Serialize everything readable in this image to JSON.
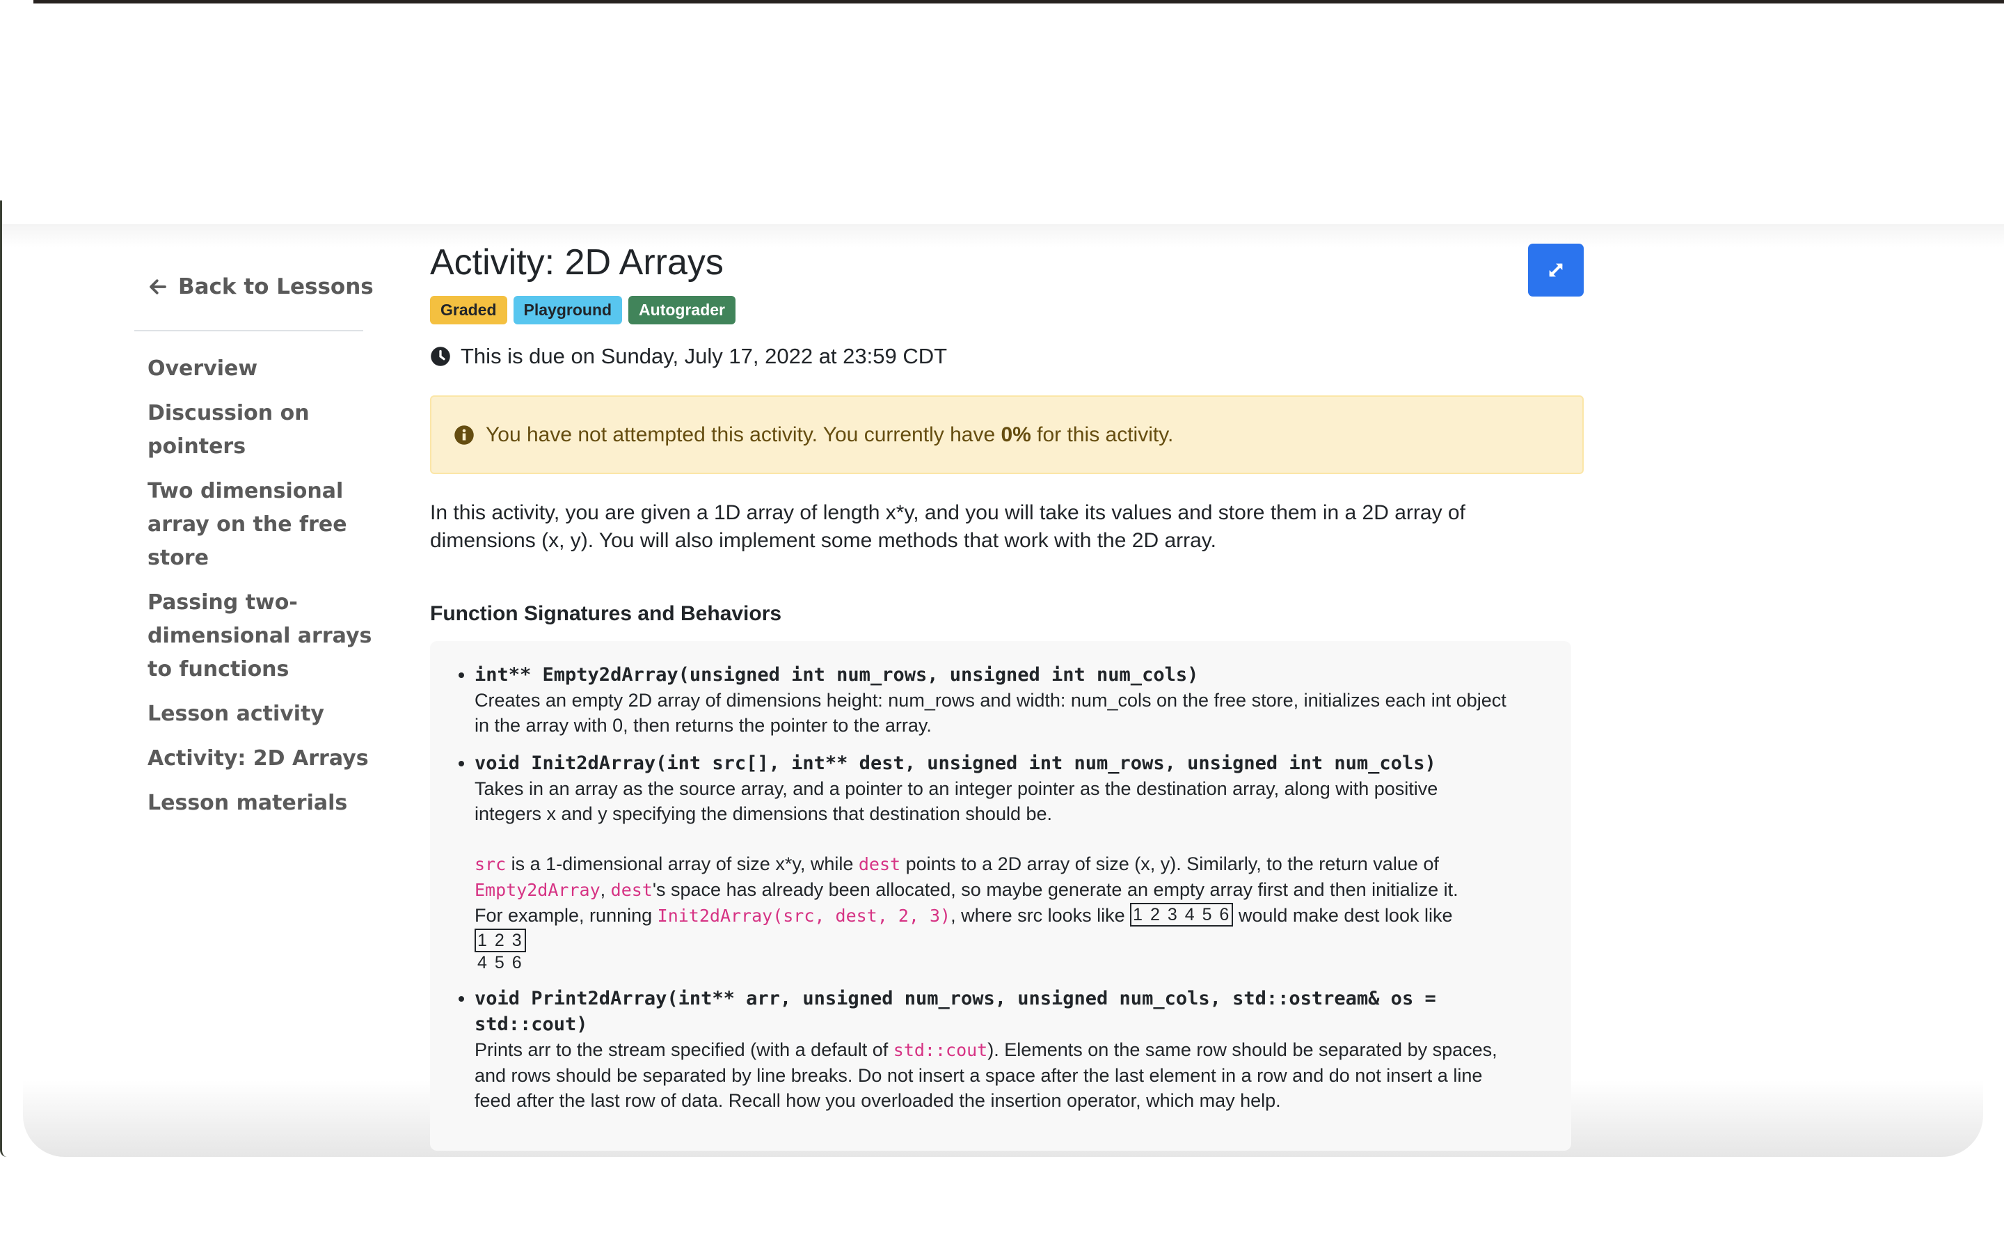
{
  "sidebar": {
    "back_label": "Back to Lessons",
    "nav_items": [
      {
        "label": "Overview"
      },
      {
        "label": "Discussion on pointers"
      },
      {
        "label": "Two dimensional array on the free store"
      },
      {
        "label": "Passing two-dimensional arrays to functions"
      },
      {
        "label": "Lesson activity"
      },
      {
        "label": "Activity: 2D Arrays"
      },
      {
        "label": "Lesson materials"
      }
    ]
  },
  "main": {
    "title": "Activity: 2D Arrays",
    "expand_icon": "expand-arrows-icon",
    "badges": [
      {
        "label": "Graded",
        "color": "#f4c040"
      },
      {
        "label": "Playground",
        "color": "#58c6ef"
      },
      {
        "label": "Autograder",
        "color": "#41845a"
      }
    ],
    "due_text": "This is due on Sunday, July 17, 2022 at 23:59 CDT",
    "alert": {
      "prefix": "You have not attempted this activity. You currently have ",
      "score": "0%",
      "suffix": " for this activity."
    },
    "intro": "In this activity, you are given a 1D array of length x*y, and you will take its values and store them in a 2D array of dimensions (x, y). You will also implement some methods that work with the 2D array.",
    "section_heading": "Function Signatures and Behaviors",
    "functions": [
      {
        "signature": "int** Empty2dArray(unsigned int num_rows, unsigned int num_cols)",
        "description": "Creates an empty 2D array of dimensions height: num_rows and width: num_cols on the free store, initializes each int object in the array with 0, then returns the pointer to the array."
      },
      {
        "signature": "void Init2dArray(int src[], int** dest, unsigned int num_rows, unsigned int num_cols)",
        "description": "Takes in an array as the source array, and a pointer to an integer pointer as the destination array, along with positive integers x and y specifying the dimensions that destination should be.",
        "p2": {
          "code_src": "src",
          "t1": " is a 1-dimensional array of size x*y, while ",
          "code_dest": "dest",
          "t2": " points to a 2D array of size (x, y). Similarly, to the return value of ",
          "code_empty": "Empty2dArray",
          "t3": ", ",
          "code_dest2": "dest",
          "t4": "'s space has already been allocated, so maybe generate an empty array first and then initialize it.",
          "t5": "For example, running ",
          "code_call": "Init2dArray(src, dest, 2, 3)",
          "t6": ", where src looks like ",
          "src_example": "1 2 3 4 5 6",
          "t7": " would make dest look like ",
          "dest_row1": "1 2 3",
          "dest_row2": "4 5 6"
        }
      },
      {
        "signature": "void Print2dArray(int** arr, unsigned num_rows, unsigned num_cols, std::ostream& os = std::cout)",
        "desc_prefix": "Prints arr to the stream specified (with a default of ",
        "desc_code": "std::cout",
        "desc_suffix": "). Elements on the same row should be separated by spaces, and rows should be separated by line breaks. Do not insert a space after the last element in a row and do not insert a line feed after the last row of data. Recall how you overloaded the insertion operator, which may help."
      }
    ]
  }
}
